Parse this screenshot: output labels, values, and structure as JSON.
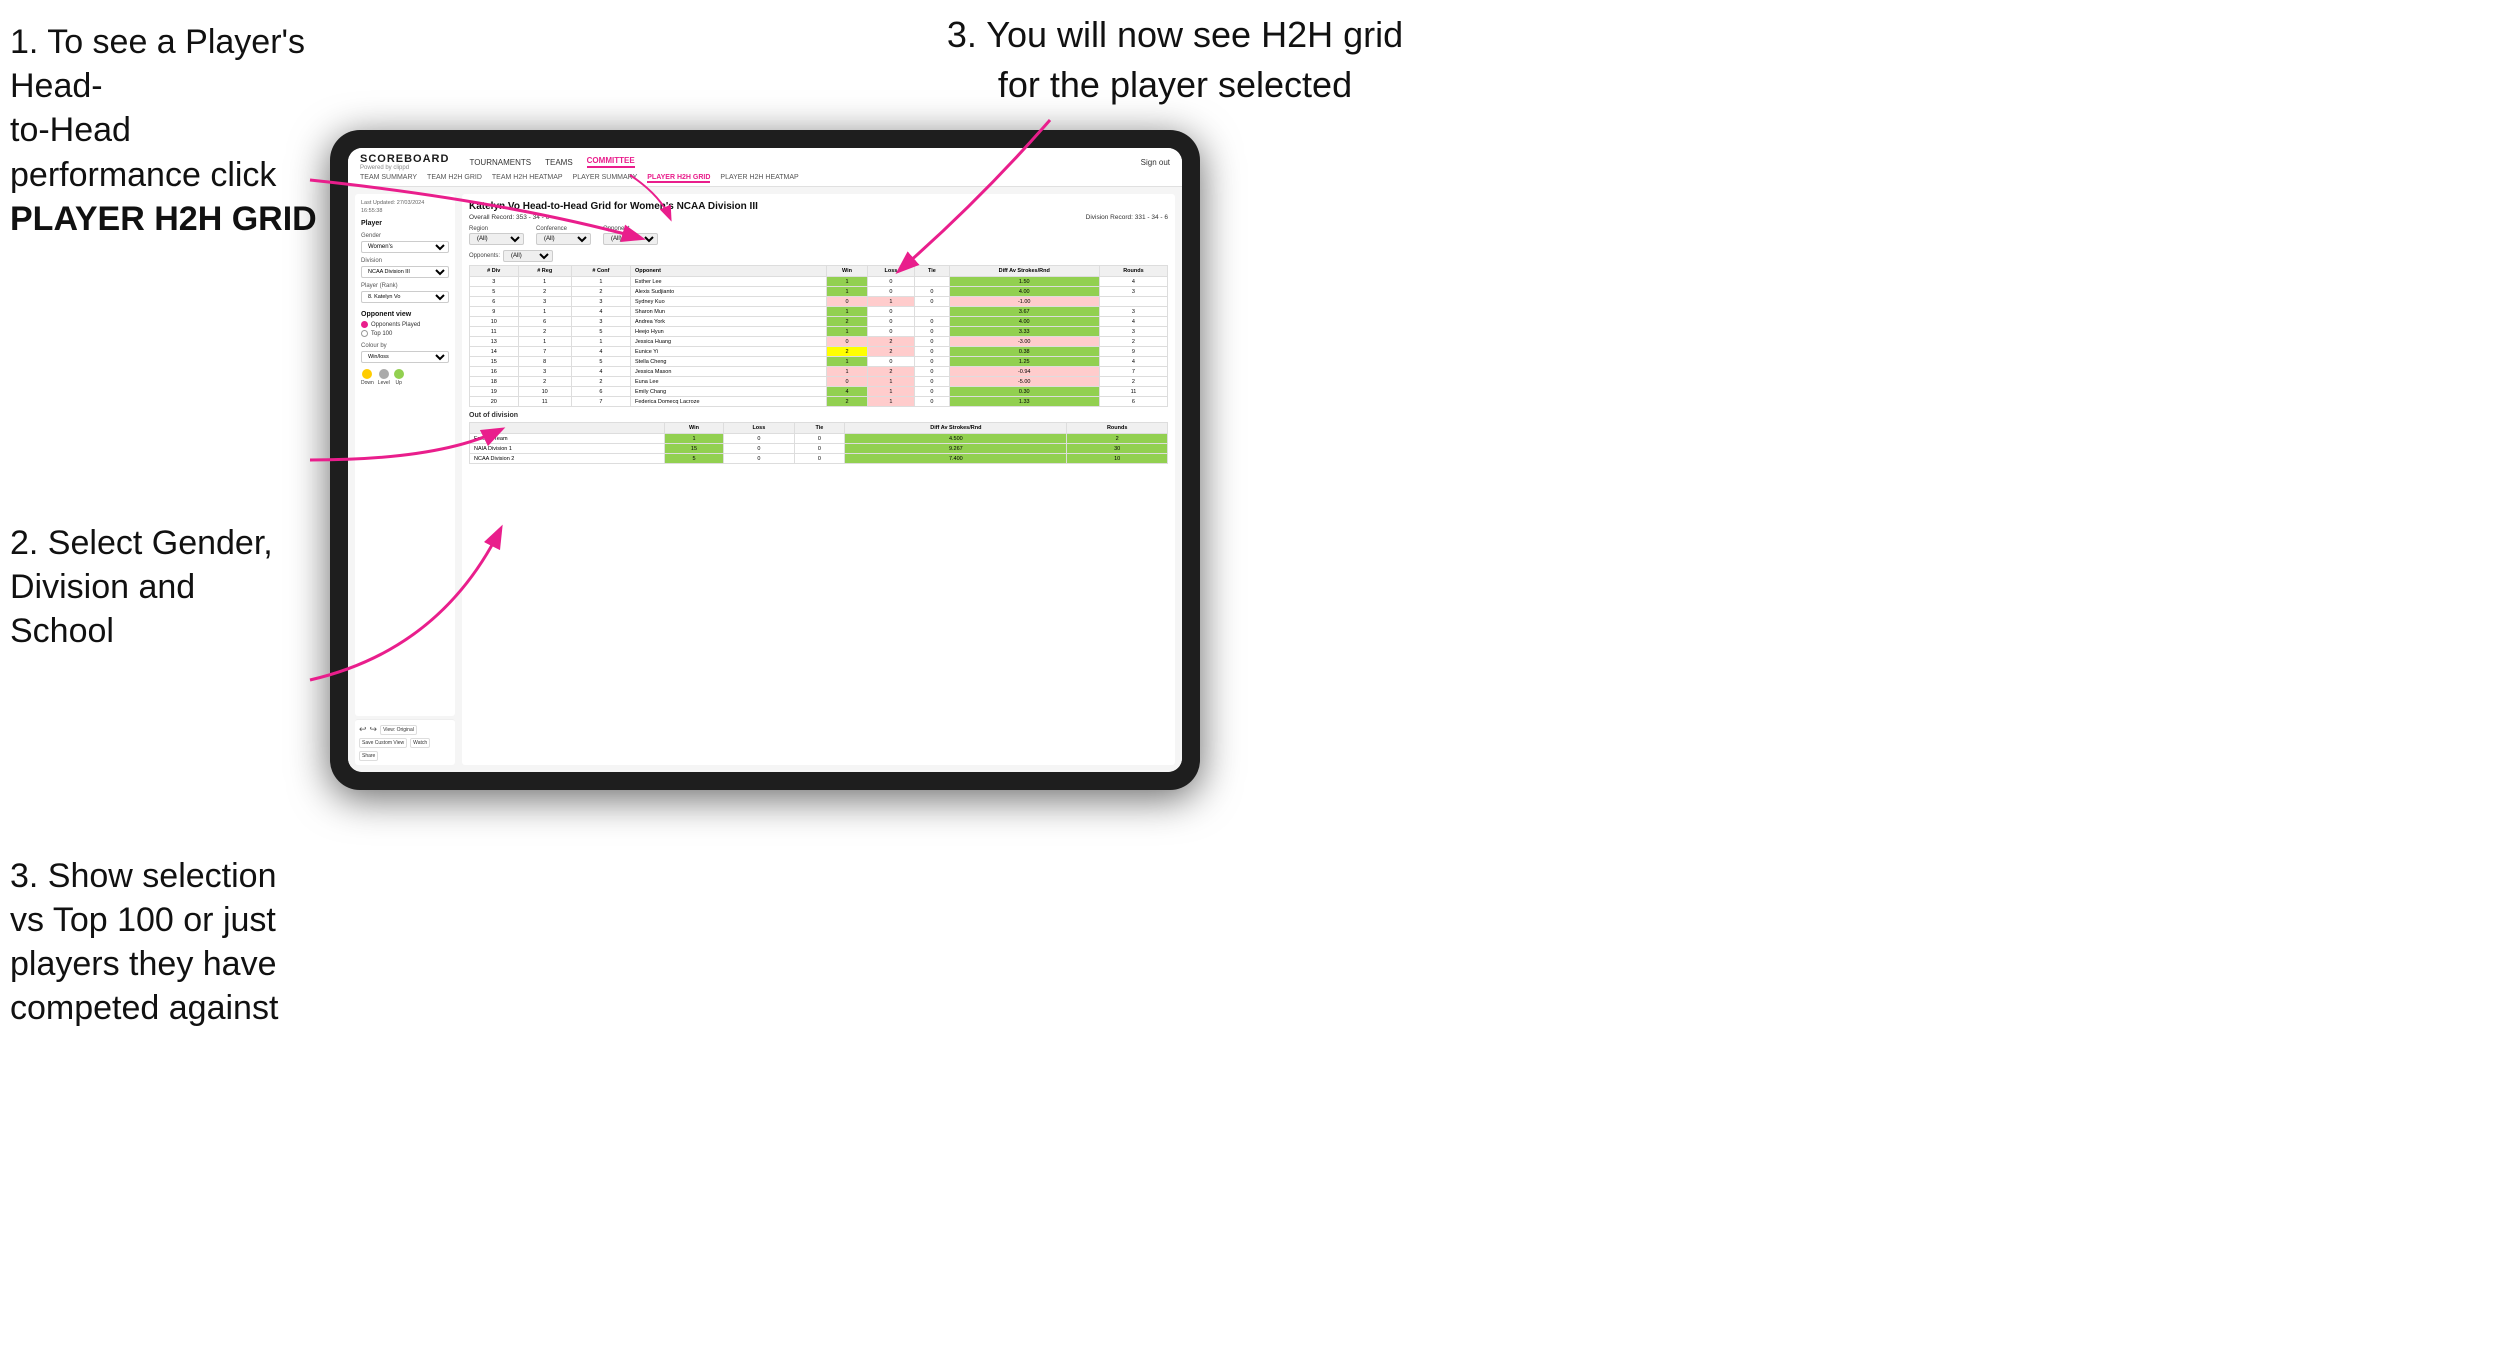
{
  "instructions": {
    "step1_line1": "1. To see a Player's Head-",
    "step1_line2": "to-Head performance click",
    "step1_bold": "PLAYER H2H GRID",
    "step2_line1": "2. Select Gender,",
    "step2_line2": "Division and",
    "step2_line3": "School",
    "step3a_line1": "3. Show selection",
    "step3a_line2": "vs Top 100 or just",
    "step3a_line3": "players they have",
    "step3a_line4": "competed against",
    "step3b_line1": "3. You will now see H2H grid",
    "step3b_line2": "for the player selected"
  },
  "nav": {
    "logo": "SCOREBOARD",
    "logo_sub": "Powered by clippd",
    "links": [
      "TOURNAMENTS",
      "TEAMS",
      "COMMITTEE"
    ],
    "sign_out": "Sign out",
    "sub_links": [
      "TEAM SUMMARY",
      "TEAM H2H GRID",
      "TEAM H2H HEATMAP",
      "PLAYER SUMMARY",
      "PLAYER H2H GRID",
      "PLAYER H2H HEATMAP"
    ]
  },
  "sidebar": {
    "updated": "Last Updated: 27/03/2024",
    "updated2": "16:55:38",
    "player_label": "Player",
    "gender_label": "Gender",
    "gender_value": "Women's",
    "division_label": "Division",
    "division_value": "NCAA Division III",
    "player_rank_label": "Player (Rank)",
    "player_rank_value": "8. Katelyn Vo",
    "opponent_view_label": "Opponent view",
    "opponents_played_label": "Opponents Played",
    "top100_label": "Top 100",
    "colour_by_label": "Colour by",
    "colour_by_value": "Win/loss",
    "down_label": "Down",
    "level_label": "Level",
    "up_label": "Up"
  },
  "table": {
    "title": "Katelyn Vo Head-to-Head Grid for Women's NCAA Division III",
    "overall_record": "Overall Record: 353 - 34 - 6",
    "division_record": "Division Record: 331 - 34 - 6",
    "opponents_label": "Opponents:",
    "opponents_value": "(All)",
    "region_label": "Region",
    "conference_label": "Conference",
    "opponent_label": "Opponent",
    "conference_filter": "(All)",
    "opponent_filter": "(All)",
    "headers": [
      "# Div",
      "# Reg",
      "# Conf",
      "Opponent",
      "Win",
      "Loss",
      "Tie",
      "Diff Av Strokes/Rnd",
      "Rounds"
    ],
    "rows": [
      {
        "div": "3",
        "reg": "1",
        "conf": "1",
        "name": "Esther Lee",
        "win": "1",
        "loss": "0",
        "tie": "",
        "diff": "1.50",
        "rounds": "4",
        "win_color": "green"
      },
      {
        "div": "5",
        "reg": "2",
        "conf": "2",
        "name": "Alexis Sudjianto",
        "win": "1",
        "loss": "0",
        "tie": "0",
        "diff": "4.00",
        "rounds": "3",
        "win_color": "green"
      },
      {
        "div": "6",
        "reg": "3",
        "conf": "3",
        "name": "Sydney Kuo",
        "win": "0",
        "loss": "1",
        "tie": "0",
        "diff": "-1.00",
        "rounds": "",
        "win_color": "red"
      },
      {
        "div": "9",
        "reg": "1",
        "conf": "4",
        "name": "Sharon Mun",
        "win": "1",
        "loss": "0",
        "tie": "",
        "diff": "3.67",
        "rounds": "3",
        "win_color": "green"
      },
      {
        "div": "10",
        "reg": "6",
        "conf": "3",
        "name": "Andrea York",
        "win": "2",
        "loss": "0",
        "tie": "0",
        "diff": "4.00",
        "rounds": "4",
        "win_color": "green"
      },
      {
        "div": "11",
        "reg": "2",
        "conf": "5",
        "name": "Heejo Hyun",
        "win": "1",
        "loss": "0",
        "tie": "0",
        "diff": "3.33",
        "rounds": "3",
        "win_color": "green"
      },
      {
        "div": "13",
        "reg": "1",
        "conf": "1",
        "name": "Jessica Huang",
        "win": "0",
        "loss": "2",
        "tie": "0",
        "diff": "-3.00",
        "rounds": "2",
        "win_color": "red"
      },
      {
        "div": "14",
        "reg": "7",
        "conf": "4",
        "name": "Eunice Yi",
        "win": "2",
        "loss": "2",
        "tie": "0",
        "diff": "0.38",
        "rounds": "9",
        "win_color": "yellow"
      },
      {
        "div": "15",
        "reg": "8",
        "conf": "5",
        "name": "Stella Cheng",
        "win": "1",
        "loss": "0",
        "tie": "0",
        "diff": "1.25",
        "rounds": "4",
        "win_color": "green"
      },
      {
        "div": "16",
        "reg": "3",
        "conf": "4",
        "name": "Jessica Mason",
        "win": "1",
        "loss": "2",
        "tie": "0",
        "diff": "-0.94",
        "rounds": "7",
        "win_color": "red"
      },
      {
        "div": "18",
        "reg": "2",
        "conf": "2",
        "name": "Euna Lee",
        "win": "0",
        "loss": "1",
        "tie": "0",
        "diff": "-5.00",
        "rounds": "2",
        "win_color": "red"
      },
      {
        "div": "19",
        "reg": "10",
        "conf": "6",
        "name": "Emily Chang",
        "win": "4",
        "loss": "1",
        "tie": "0",
        "diff": "0.30",
        "rounds": "11",
        "win_color": "green"
      },
      {
        "div": "20",
        "reg": "11",
        "conf": "7",
        "name": "Federica Domecq Lacroze",
        "win": "2",
        "loss": "1",
        "tie": "0",
        "diff": "1.33",
        "rounds": "6",
        "win_color": "green"
      }
    ],
    "out_of_division_label": "Out of division",
    "out_rows": [
      {
        "name": "Foreign Team",
        "win": "1",
        "loss": "0",
        "tie": "0",
        "diff": "4.500",
        "rounds": "2"
      },
      {
        "name": "NAIA Division 1",
        "win": "15",
        "loss": "0",
        "tie": "0",
        "diff": "9.267",
        "rounds": "30"
      },
      {
        "name": "NCAA Division 2",
        "win": "5",
        "loss": "0",
        "tie": "0",
        "diff": "7.400",
        "rounds": "10"
      }
    ]
  },
  "toolbar": {
    "buttons": [
      "View: Original",
      "Save Custom View",
      "Watch",
      "Share"
    ]
  },
  "colors": {
    "accent": "#e91e8c",
    "green": "#92d050",
    "yellow": "#ffff00",
    "red": "#ff9999",
    "nav_active": "#e91e8c"
  }
}
